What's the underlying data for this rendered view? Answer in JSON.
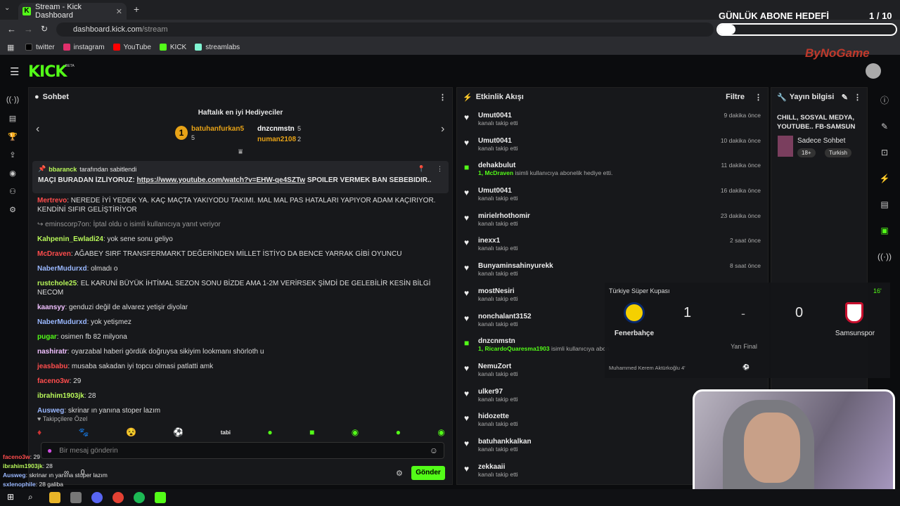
{
  "browser": {
    "tab_title": "Stream - Kick Dashboard",
    "url_host": "dashboard.kick.com",
    "url_path": "/stream",
    "bookmarks": [
      "twitter",
      "instagram",
      "YouTube",
      "KICK",
      "streamlabs"
    ]
  },
  "overlay": {
    "goal_title": "GÜNLÜK ABONE HEDEFİ",
    "goal_count": "1 / 10",
    "brand": "ByNoGame"
  },
  "site": {
    "logo": "KICK",
    "logo_badge": "BETA"
  },
  "chat": {
    "title": "Sohbet",
    "gifters_title": "Haftalık en iyi Hediyeciler",
    "gifters": [
      {
        "name": "batuhanfurkan5",
        "count": "5"
      },
      {
        "name": "dnzcnmstn",
        "count": "5"
      },
      {
        "name": "numan2108",
        "count": "2"
      }
    ],
    "pinned_by": "bbaranck",
    "pinned_suffix": "tarafından sabitlendi",
    "pinned_prefix": "MAÇI BURADAN İZLİYORUZ:",
    "pinned_link": "https://www.youtube.com/watch?v=EHW-qe4SZTw",
    "pinned_suffix2": "SPOILER VERMEK BAN SEBEBIDIR..",
    "messages": [
      {
        "user": "Mertrevo",
        "color": "#ff4d4d",
        "text": ": NEREDE İYİ YEDEK YA. KAÇ MAÇTA YAKIYODU TAKIMI. MAL MAL PAS HATALARI YAPIYOR ADAM KAÇIRIYOR. KENDİNİ SIFIR GELİŞTİRİYOR"
      },
      {
        "user": "",
        "color": "#999",
        "text": "↪ eminscorp7on: İptal oldu o isimli kullanıcıya yanıt veriyor"
      },
      {
        "user": "Kahpenin_Ewladi24",
        "color": "#b8f75a",
        "text": ": yok sene sonu geliyo"
      },
      {
        "user": "McDraven",
        "color": "#ff4d4d",
        "text": ": AĞABEY SIRF TRANSFERMARKT DEĞERİNDEN MİLLET İSTİYO DA BENCE YARRAK GİBİ OYUNCU"
      },
      {
        "user": "NaberMudurxd",
        "color": "#9ab8ff",
        "text": ": olmadı o"
      },
      {
        "user": "rustchole25",
        "color": "#b8f75a",
        "text": ": EL KARUNİ BÜYÜK İHTİMAL SEZON SONU BİZDE AMA 1-2M VERİRSEK ŞİMDİ DE GELEBİLİR KESİN BİLGİ NECOM"
      },
      {
        "user": "kaansyy",
        "color": "#f0c0ff",
        "text": ": genduzi değil de alvarez yetişir diyolar"
      },
      {
        "user": "NaberMudurxd",
        "color": "#9ab8ff",
        "text": ": yok yetişmez"
      },
      {
        "user": "pugar",
        "color": "#53fc18",
        "text": ": osimen fb 82 milyona"
      },
      {
        "user": "nashiratr",
        "color": "#f0c0ff",
        "text": ": oyarzabal haberi gördük doğruysa sikiyim lookmanı shörloth u"
      },
      {
        "user": "jeasbabu",
        "color": "#ff4d4d",
        "text": ": musaba sakadan iyi topcu olmasi patlatti amk"
      },
      {
        "user": "faceno3w",
        "color": "#ff4d4d",
        "text": ": 29"
      },
      {
        "user": "ibrahim1903jk",
        "color": "#b8f75a",
        "text": ": 28"
      },
      {
        "user": "Ausweg",
        "color": "#9ab8ff",
        "text": ": skrinar ın yanına stoper lazım"
      },
      {
        "user": "sxlenophile",
        "color": "#9ab8ff",
        "text": ": 28 galiba"
      }
    ],
    "followers_only": "Takipçilere Özel",
    "input_placeholder": "Bir mesaj gönderin",
    "send_label": "Gönder",
    "viewers": "0",
    "loop_count": "0"
  },
  "activity": {
    "title": "Etkinlik Akışı",
    "filter": "Filtre",
    "events": [
      {
        "user": "Umut0041",
        "sub": "kanalı takip etti",
        "time": "9 dakika önce",
        "type": "follow"
      },
      {
        "user": "Umut0041",
        "sub": "kanalı takip etti",
        "time": "10 dakika önce",
        "type": "follow"
      },
      {
        "user": "dehakbulut",
        "sub_user": "1, McDraven",
        "sub": "isimli kullanıcıya abonelik hediye etti.",
        "time": "11 dakika önce",
        "type": "gift"
      },
      {
        "user": "Umut0041",
        "sub": "kanalı takip etti",
        "time": "16 dakika önce",
        "type": "follow"
      },
      {
        "user": "mirielrhothomir",
        "sub": "kanalı takip etti",
        "time": "23 dakika önce",
        "type": "follow"
      },
      {
        "user": "inexx1",
        "sub": "kanalı takip etti",
        "time": "2 saat önce",
        "type": "follow"
      },
      {
        "user": "Bunyaminsahinyurekk",
        "sub": "kanalı takip etti",
        "time": "8 saat önce",
        "type": "follow"
      },
      {
        "user": "mostNesiri",
        "sub": "kanalı takip etti",
        "time": "",
        "type": "follow"
      },
      {
        "user": "nonchalant3152",
        "sub": "kanalı takip etti",
        "time": "",
        "type": "follow"
      },
      {
        "user": "dnzcnmstn",
        "sub_user": "1, RicardoQuaresma1903",
        "sub": "isimli kullanıcıya abon",
        "time": "",
        "type": "gift"
      },
      {
        "user": "NemuZort",
        "sub": "kanalı takip etti",
        "time": "",
        "type": "follow"
      },
      {
        "user": "ulker97",
        "sub": "kanalı takip etti",
        "time": "",
        "type": "follow"
      },
      {
        "user": "hidozette",
        "sub": "kanalı takip etti",
        "time": "",
        "type": "follow"
      },
      {
        "user": "batuhankkalkan",
        "sub": "kanalı takip etti",
        "time": "",
        "type": "follow"
      },
      {
        "user": "zekkaaii",
        "sub": "kanalı takip etti",
        "time": "",
        "type": "follow"
      }
    ]
  },
  "stream_info": {
    "title": "Yayın bilgisi",
    "stream_title": "CHILL, SOSYAL MEDYA, YOUTUBE.. FB-SAMSUN",
    "category": "Sadece Sohbet",
    "tags": [
      "18+",
      "Turkish"
    ]
  },
  "scoreboard": {
    "competition": "Türkiye Süper Kupası",
    "minute": "16'",
    "home": "Fenerbahçe",
    "away": "Samsunspor",
    "home_score": "1",
    "away_score": "0",
    "sep": "-",
    "stage": "Yarı Final",
    "scorer": "Muhammed Kerem Aktürkoğlu 4'"
  },
  "overlay_chat": [
    {
      "user": "faceno3w",
      "text": ": 29"
    },
    {
      "user": "ibrahim1903jk",
      "text": ": 28"
    },
    {
      "user": "Ausweg",
      "text": ": skrinar ın yanına stoper lazım"
    },
    {
      "user": "sxlenophile",
      "text": ": 28 galiba"
    }
  ],
  "colors": {
    "accent": "#53fc18"
  }
}
